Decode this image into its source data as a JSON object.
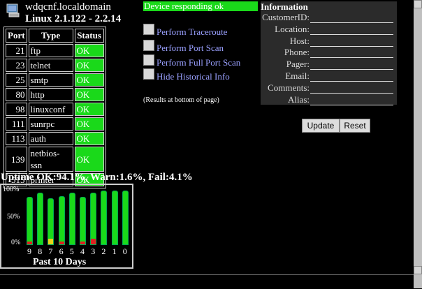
{
  "header": {
    "hostname": "wdqcnf.localdomain",
    "os": "Linux 2.1.122 - 2.2.14"
  },
  "ports": {
    "headers": [
      "Port",
      "Type",
      "Status"
    ],
    "rows": [
      {
        "port": "21",
        "type": "ftp",
        "status": "OK"
      },
      {
        "port": "23",
        "type": "telnet",
        "status": "OK"
      },
      {
        "port": "25",
        "type": "smtp",
        "status": "OK"
      },
      {
        "port": "80",
        "type": "http",
        "status": "OK"
      },
      {
        "port": "98",
        "type": "linuxconf",
        "status": "OK"
      },
      {
        "port": "111",
        "type": "sunrpc",
        "status": "OK"
      },
      {
        "port": "113",
        "type": "auth",
        "status": "OK"
      },
      {
        "port": "139",
        "type": "netbios-ssn",
        "status": "OK"
      },
      {
        "port": "515",
        "type": "printer",
        "status": "OK"
      }
    ]
  },
  "device_status": "Device responding ok",
  "actions": [
    {
      "label": "Perform Traceroute",
      "icon": "traceroute-icon"
    },
    {
      "label": "Perform Port Scan",
      "icon": "port-scan-icon"
    },
    {
      "label": "Perform Full Port Scan",
      "icon": "full-port-scan-icon"
    },
    {
      "label": "Hide Historical Info",
      "icon": "history-icon"
    }
  ],
  "note": "(Results at bottom of page)",
  "info": {
    "title": "Information",
    "fields": [
      "CustomerID:",
      "Location:",
      "Host:",
      "Phone:",
      "Pager:",
      "Email:",
      "Comments:",
      "Alias:"
    ],
    "update_label": "Update",
    "reset_label": "Reset"
  },
  "uptime": {
    "summary": "Uptime OK:94.1%, Warn:1.6%, Fail:4.1%",
    "caption": "Past 10 Days"
  },
  "colors": {
    "ok": "#1ad91a",
    "warn": "#e8d419",
    "fail": "#e02020"
  },
  "chart_data": {
    "type": "bar",
    "categories": [
      "9",
      "8",
      "7",
      "6",
      "5",
      "4",
      "3",
      "2",
      "1",
      "0"
    ],
    "series": [
      {
        "values": [
          88,
          96,
          86,
          90,
          96,
          88,
          96,
          100,
          100,
          100
        ]
      }
    ],
    "warn": [
      0,
      0,
      10,
      0,
      0,
      0,
      0,
      0,
      0,
      0
    ],
    "fail": [
      5,
      0,
      0,
      5,
      0,
      5,
      10,
      0,
      0,
      0
    ],
    "yticks": [
      "100%",
      "50%",
      "0%"
    ],
    "ylim": [
      0,
      100
    ],
    "xlabel": "Past 10 Days"
  }
}
